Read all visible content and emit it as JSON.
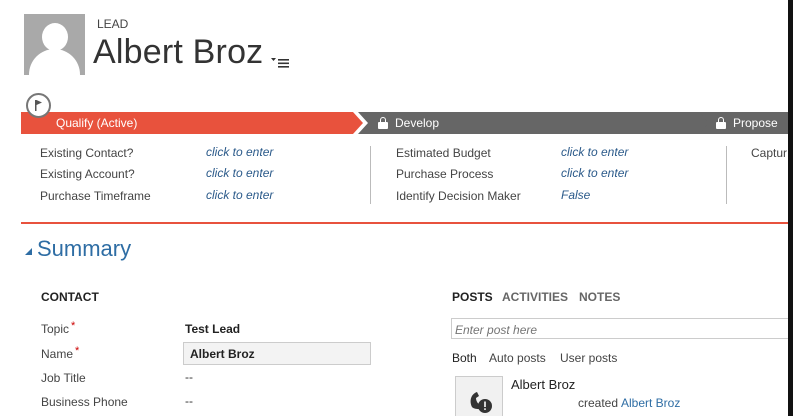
{
  "header": {
    "entity_type": "LEAD",
    "record_name": "Albert Broz"
  },
  "process": {
    "stages": [
      {
        "label": "Qualify (Active)",
        "state": "active"
      },
      {
        "label": "Develop",
        "state": "locked"
      },
      {
        "label": "Propose",
        "state": "locked"
      }
    ],
    "fields_col1": [
      {
        "label": "Existing Contact?",
        "value": "click to enter"
      },
      {
        "label": "Existing Account?",
        "value": "click to enter"
      },
      {
        "label": "Purchase Timeframe",
        "value": "click to enter"
      }
    ],
    "fields_col2": [
      {
        "label": "Estimated Budget",
        "value": "click to enter"
      },
      {
        "label": "Purchase Process",
        "value": "click to enter"
      },
      {
        "label": "Identify Decision Maker",
        "value": "False"
      }
    ],
    "fields_col3": [
      {
        "label": "Captur"
      }
    ]
  },
  "summary": {
    "title": "Summary",
    "contact": {
      "heading": "CONTACT",
      "fields": [
        {
          "label": "Topic",
          "value": "Test Lead",
          "required": "*"
        },
        {
          "label": "Name",
          "value": "Albert Broz",
          "required": "*"
        },
        {
          "label": "Job Title",
          "value": "--"
        },
        {
          "label": "Business Phone",
          "value": "--"
        }
      ]
    }
  },
  "social": {
    "tabs": [
      "POSTS",
      "ACTIVITIES",
      "NOTES"
    ],
    "post_placeholder": "Enter post here",
    "filters": [
      "Both",
      "Auto posts",
      "User posts"
    ],
    "post": {
      "author": "Albert Broz",
      "action": "created",
      "target": "Albert Broz"
    }
  },
  "colors": {
    "accent": "#e8523d",
    "stage_locked": "#666666",
    "link": "#2e6da4"
  }
}
